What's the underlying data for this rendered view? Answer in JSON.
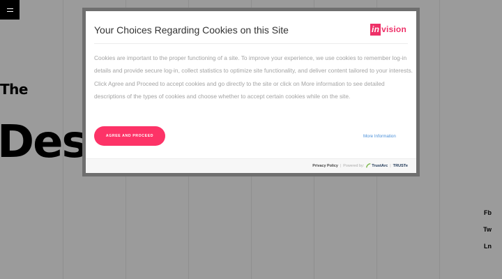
{
  "background": {
    "hero_line1": "The",
    "hero_line2": "Desi",
    "social": [
      "Fb",
      "Tw",
      "Ln"
    ]
  },
  "modal": {
    "title": "Your Choices Regarding Cookies on this Site",
    "logo_in": "in",
    "logo_vision": "vision",
    "body": "Cookies are important to the proper functioning of a site. To improve your experience, we use cookies to remember log-in details and provide secure log-in, collect statistics to optimize site functionality, and deliver content tailored to your interests. Click Agree and Proceed to accept cookies and go directly to the site or click on More information to see detailed descriptions of the types of cookies and choose whether to accept certain cookies while on the site.",
    "agree_label": "Agree and Proceed",
    "more_info_label": "More Information",
    "footer": {
      "privacy_label": "Privacy Policy",
      "separator": "|",
      "powered_by": "Powered by:",
      "trustarc": "TrustArc",
      "divider": "|",
      "truste": "TRUSTe"
    }
  },
  "colors": {
    "accent": "#fd3367",
    "brand": "#ee3168",
    "link": "#4a90d9",
    "overlay": "#9b9b9b"
  }
}
